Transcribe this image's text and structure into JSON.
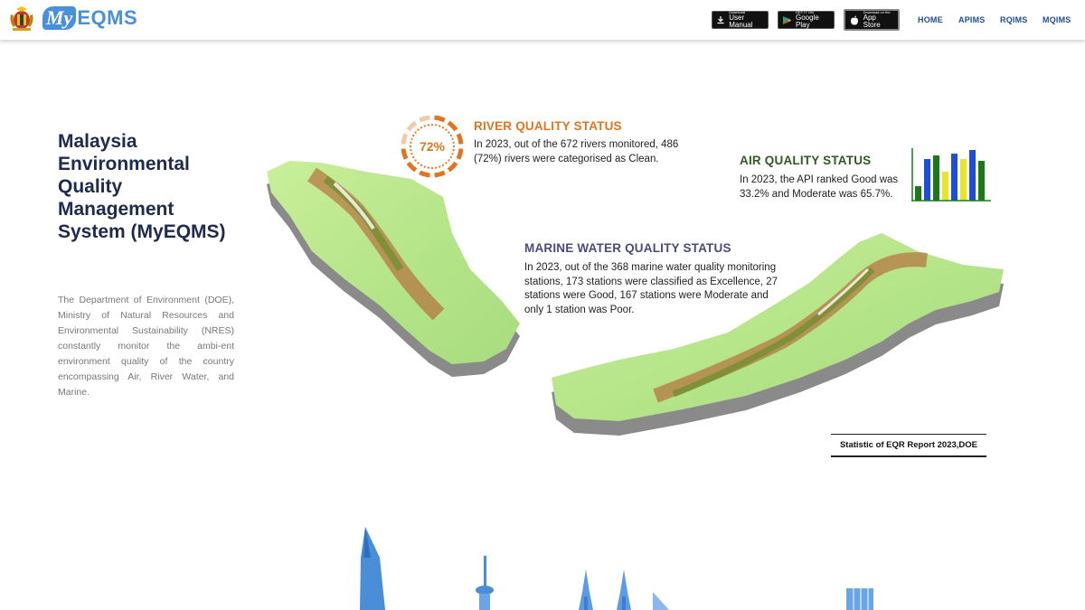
{
  "header": {
    "brand_my": "My",
    "brand_eqms": "EQMS",
    "buttons": {
      "manual": {
        "small": "Download",
        "big": "User Manual"
      },
      "gplay": {
        "small": "GET IT ON",
        "big": "Google Play"
      },
      "appstore": {
        "small": "Download on the",
        "big": "App Store"
      }
    },
    "nav": {
      "home": "HOME",
      "apims": "APIMS",
      "rqims": "RQIMS",
      "mqims": "MQIMS"
    }
  },
  "main": {
    "title": "Malaysia Environmental Quality Management System (MyEQMS)",
    "description": "The Department of Environment (DOE), Ministry of Natural Resources and Environmental Sustainability (NRES) constantly monitor the ambi-ent environment quality of the country encompassing Air, River Water, and Marine."
  },
  "stats": {
    "river": {
      "title": "RIVER QUALITY STATUS",
      "gauge_label": "72%",
      "gauge_value": 72,
      "text": "In 2023, out of the 672 rivers monitored, 486 (72%) rivers were categorised as Clean."
    },
    "air": {
      "title": "AIR QUALITY STATUS",
      "text": "In 2023, the API ranked Good was 33.2% and Moderate was 65.7%."
    },
    "marine": {
      "title": "MARINE WATER QUALITY STATUS",
      "text": "In 2023, out of the 368 marine water quality monitoring stations, 173 stations were classified as Excellence, 27 stations were Good, 167 stations were Moderate and only 1 station was Poor."
    },
    "source": "Statistic of EQR Report 2023,DOE"
  },
  "colors": {
    "river": "#e4731f",
    "air": "#2e5b1f",
    "marine": "#4a4a7f",
    "nav": "#1f4e8c",
    "title": "#1e2a4e",
    "brand": "#4a90d9"
  },
  "icons": {
    "crest": "malaysia-crest-icon",
    "manual": "download-icon",
    "gplay": "google-play-icon",
    "appstore": "apple-icon"
  }
}
